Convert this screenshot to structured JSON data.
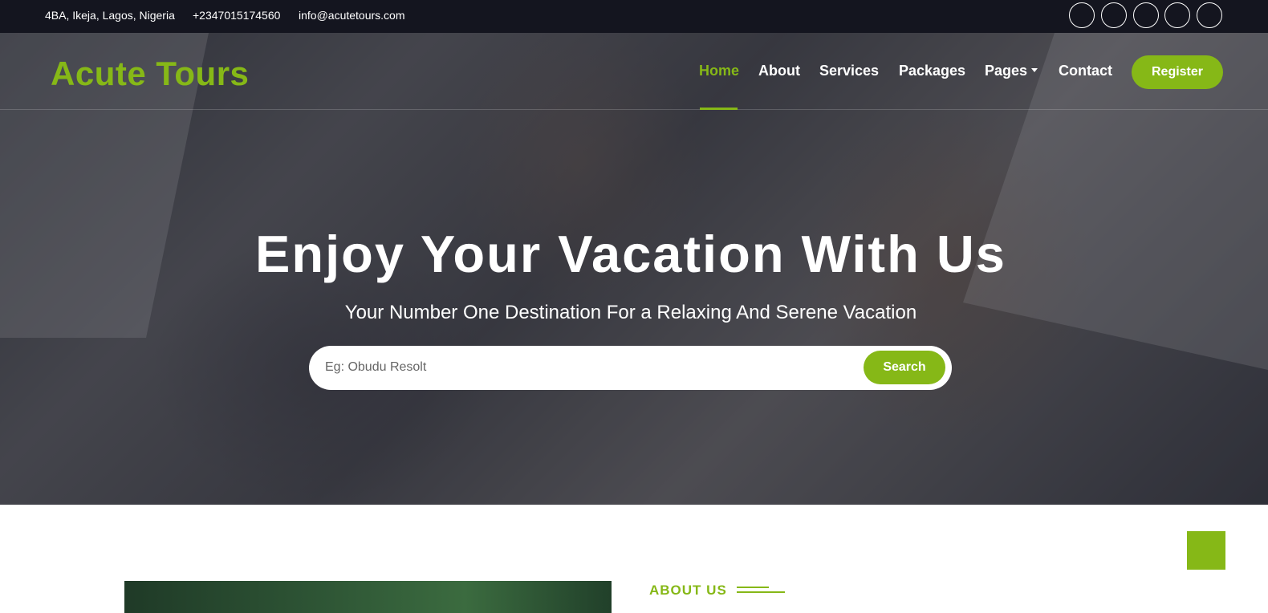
{
  "topbar": {
    "address": "4BA, Ikeja, Lagos, Nigeria",
    "phone": "+2347015174560",
    "email": "info@acutetours.com",
    "social_icons": [
      "twitter-icon",
      "facebook-icon",
      "youtube-icon",
      "linkedin-icon",
      "instagram-icon"
    ]
  },
  "brand": {
    "name": "Acute Tours"
  },
  "nav": {
    "items": [
      {
        "label": "Home",
        "active": true
      },
      {
        "label": "About"
      },
      {
        "label": "Services"
      },
      {
        "label": "Packages"
      },
      {
        "label": "Pages"
      },
      {
        "label": "Contact"
      }
    ],
    "register_label": "Register"
  },
  "hero": {
    "title": "Enjoy Your Vacation With Us",
    "subtitle": "Your Number One Destination For a Relaxing And Serene Vacation",
    "search_placeholder": "Eg: Obudu Resolt",
    "search_button": "Search"
  },
  "about": {
    "label": "ABOUT US"
  },
  "colors": {
    "accent": "#86b817",
    "topbar_bg": "#14151f",
    "text_light": "#ffffff"
  }
}
